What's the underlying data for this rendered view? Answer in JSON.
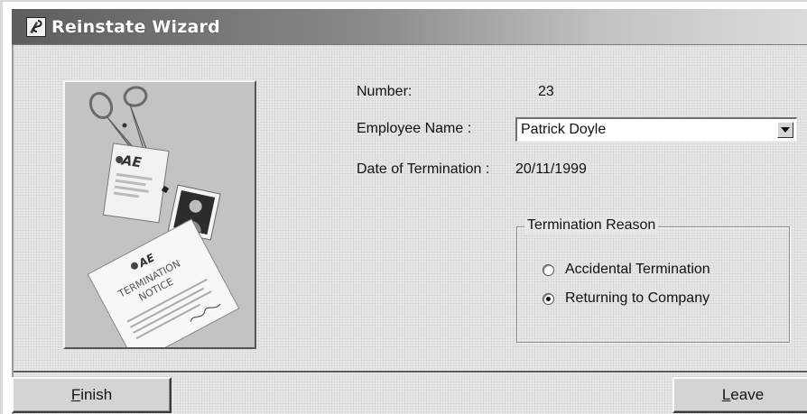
{
  "window": {
    "title": "Reinstate Wizard",
    "icon": "app-icon"
  },
  "fields": {
    "number_label": "Number:",
    "number_value": "23",
    "employee_label": "Employee Name :",
    "employee_value": "Patrick Doyle",
    "date_label": "Date of Termination :",
    "date_value": "20/11/1999"
  },
  "termination_reason": {
    "legend": "Termination Reason",
    "options": [
      {
        "label": "Accidental Termination",
        "selected": false
      },
      {
        "label": "Returning to Company",
        "selected": true
      }
    ]
  },
  "picture": {
    "logo_text": "AE",
    "notice_title_line1": "TERMINATION",
    "notice_title_line2": "NOTICE"
  },
  "buttons": {
    "finish_mnemonic": "F",
    "finish_rest": "inish",
    "leave_mnemonic": "L",
    "leave_rest": "eave"
  },
  "colors": {
    "titlebar_dark": "#5e5e5e",
    "client_bg": "#e6e6e6",
    "picture_bg": "#c3c3c3"
  }
}
